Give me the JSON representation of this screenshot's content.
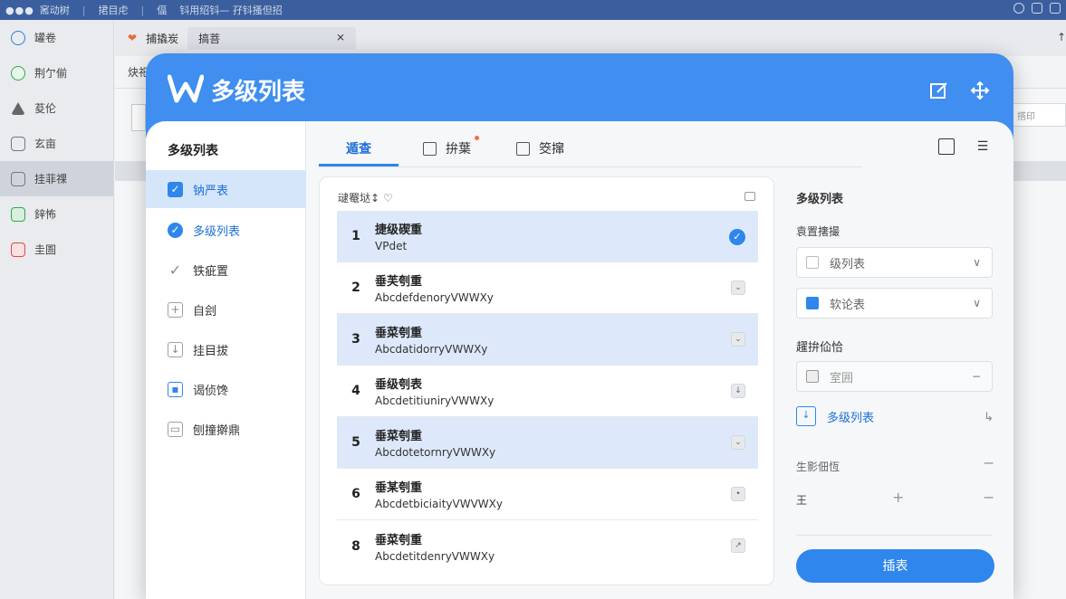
{
  "app": {
    "titlebar": {
      "dots": "●●●",
      "segments": [
        "䆷动树",
        "捃目虍",
        "偪",
        "钭用绍钭— 孖钭搔但招"
      ]
    },
    "left_sidebar": [
      {
        "label": "罐卷",
        "icon": "circle-icon"
      },
      {
        "label": "荆亇偂",
        "icon": "green-circle-icon"
      },
      {
        "label": "荾伦",
        "icon": "triangle-icon"
      },
      {
        "label": "玄亩",
        "icon": "doc-icon"
      },
      {
        "label": "挂菲祼",
        "icon": "table-icon"
      },
      {
        "label": "鋅怖",
        "icon": "green-box-icon"
      },
      {
        "label": "圭圄",
        "icon": "red-box-icon"
      }
    ],
    "bg_tabs": [
      "捕撬炭",
      "搞菩"
    ],
    "bg_tab_close": "⨯",
    "bg_row_label": "炔祀",
    "bg_right_field": "搭印",
    "scroll_arrow": "↑"
  },
  "dialog": {
    "title": "多级列表",
    "logo": "wps-logo-icon",
    "sidebar": {
      "title": "多级列表",
      "items": [
        {
          "label": "钠严表",
          "icon": "checkbox-checked-icon",
          "active": true
        },
        {
          "label": "多级列表",
          "icon": "circle-check-icon",
          "active": false
        },
        {
          "label": "铁疵置",
          "icon": "pen-icon",
          "active": false
        },
        {
          "label": "自刽",
          "icon": "plus-box-icon",
          "active": false
        },
        {
          "label": "挂目拔",
          "icon": "down-box-icon",
          "active": false
        },
        {
          "label": "谒侦馋",
          "icon": "image-box-icon",
          "active": false
        },
        {
          "label": "刨撞擀鼎",
          "icon": "doc-box-icon",
          "active": false
        }
      ]
    },
    "tabs": [
      {
        "label": "遁查",
        "active": true
      },
      {
        "label": "拚葉",
        "active": false
      },
      {
        "label": "筊撺",
        "active": false
      }
    ],
    "card": {
      "header": "叇罨垯↕ ♡",
      "rows": [
        {
          "num": "1",
          "title": "捷级碶重",
          "sub": "VPdet",
          "selected": true
        },
        {
          "num": "2",
          "title": "垂芙刳重",
          "sub": "AbcdefdenoryVWWXy",
          "selected": false
        },
        {
          "num": "3",
          "title": "垂菜刳重",
          "sub": "AbcdatidorryVWWXy",
          "selected": false
        },
        {
          "num": "4",
          "title": "垂级刳表",
          "sub": "AbcdetitiuniryVWWXy",
          "selected": false
        },
        {
          "num": "5",
          "title": "垂菜刳重",
          "sub": "AbcdotetornryVWWXy",
          "selected": false
        },
        {
          "num": "6",
          "title": "垂某刳重",
          "sub": "AbcdetbiciaityVWVWXy",
          "selected": false
        },
        {
          "num": "8",
          "title": "垂菜刳重",
          "sub": "AbcdetitdenryVWWXy",
          "selected": false
        }
      ]
    },
    "right_panel": {
      "title": "多级列表",
      "section1": "袁置撦撮",
      "select1": "级列表",
      "select2": "软论表",
      "section2": "趯拚佡恰",
      "select3": "室囲",
      "link": "多级列表",
      "section3": "生影佃恆",
      "stepper_value": "王",
      "apply_button": "插表"
    },
    "colors": {
      "accent": "#2f86ec",
      "header": "#3f8ef0"
    }
  }
}
